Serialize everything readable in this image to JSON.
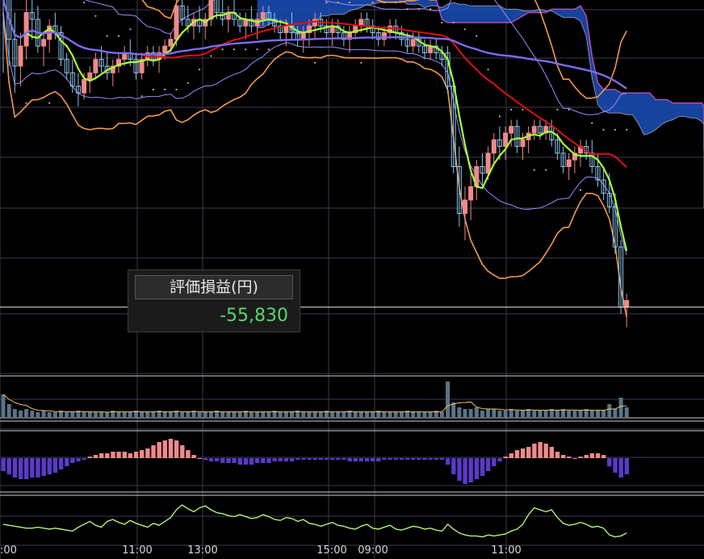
{
  "pl_panel": {
    "title": "評価損益(円)",
    "value": "-55,830"
  },
  "colors": {
    "background": "#000000",
    "grid": "#3b3b52",
    "up_candle": "#f08a8a",
    "down_candle": "#8cc8f0",
    "ma_short": "#a8ff3c",
    "ma_mid": "#e01010",
    "ma_long": "#7b6cf0",
    "bollinger_outer": "#f39a4a",
    "bollinger_inner": "#9a8cff",
    "cloud_upper": "#1a4fb8",
    "cloud_lower": "#b04cb8",
    "sar": "#f0a0a0",
    "macd_positive": "#f08a8a",
    "macd_negative": "#5a3ac8",
    "rsi": "#b6f07a"
  },
  "chart_data": {
    "type": "candlestick",
    "x_tick_labels": [
      ":00",
      "11:00",
      "13:00",
      "15:00",
      "09:00",
      "11:00"
    ],
    "gridlines": true,
    "legend": "none",
    "current_price_line": true,
    "panels": [
      "price",
      "volume",
      "macd_histogram",
      "rsi"
    ],
    "price": {
      "session1": [
        [
          29,
          30,
          9,
          20
        ],
        [
          20,
          24,
          10,
          14
        ],
        [
          14,
          18,
          6,
          10
        ],
        [
          10,
          15,
          7,
          13
        ],
        [
          13,
          21,
          11,
          18
        ],
        [
          18,
          22,
          14,
          17
        ],
        [
          17,
          19,
          12,
          13
        ],
        [
          13,
          15,
          10,
          14
        ],
        [
          14,
          17,
          12,
          16
        ],
        [
          16,
          18,
          14,
          15
        ],
        [
          15,
          16,
          10,
          11
        ],
        [
          11,
          12,
          8,
          9
        ],
        [
          9,
          11,
          6,
          7
        ],
        [
          7,
          9,
          4,
          6
        ],
        [
          6,
          9,
          5,
          8
        ],
        [
          8,
          10,
          6,
          9
        ],
        [
          9,
          12,
          8,
          11
        ],
        [
          11,
          13,
          9,
          10
        ],
        [
          10,
          12,
          8,
          9
        ],
        [
          9,
          11,
          7,
          10
        ],
        [
          10,
          12,
          9,
          11
        ],
        [
          11,
          13,
          10,
          12
        ],
        [
          12,
          14,
          10,
          11
        ],
        [
          11,
          12,
          8,
          9
        ],
        [
          9,
          12,
          8,
          11
        ],
        [
          11,
          13,
          10,
          12
        ],
        [
          12,
          13,
          10,
          11
        ],
        [
          11,
          13,
          9,
          12
        ],
        [
          12,
          14,
          11,
          13
        ],
        [
          13,
          15,
          12,
          14
        ],
        [
          14,
          20,
          13,
          19
        ],
        [
          19,
          23,
          16,
          17
        ],
        [
          17,
          19,
          15,
          16
        ],
        [
          16,
          18,
          14,
          17
        ],
        [
          17,
          19,
          15,
          16
        ],
        [
          16,
          18,
          14,
          17
        ],
        [
          17,
          21,
          16,
          20
        ],
        [
          20,
          22,
          17,
          18
        ],
        [
          18,
          20,
          16,
          17
        ],
        [
          17,
          19,
          15,
          18
        ],
        [
          18,
          20,
          16,
          17
        ],
        [
          17,
          18,
          15,
          16
        ],
        [
          16,
          18,
          14,
          17
        ],
        [
          17,
          19,
          15,
          16
        ],
        [
          16,
          18,
          14,
          17
        ],
        [
          17,
          19,
          16,
          18
        ],
        [
          18,
          19,
          16,
          17
        ],
        [
          17,
          18,
          15,
          16
        ],
        [
          16,
          17,
          14,
          15
        ],
        [
          15,
          17,
          13,
          16
        ],
        [
          16,
          18,
          14,
          15
        ],
        [
          15,
          16,
          13,
          14
        ],
        [
          14,
          16,
          12,
          15
        ],
        [
          15,
          17,
          13,
          16
        ],
        [
          16,
          18,
          14,
          17
        ],
        [
          17,
          18,
          15,
          16
        ],
        [
          16,
          17,
          14,
          15
        ],
        [
          15,
          17,
          13,
          16
        ],
        [
          16,
          17,
          14,
          15
        ],
        [
          15,
          16,
          13,
          14
        ],
        [
          14,
          16,
          12,
          15
        ],
        [
          15,
          17,
          14,
          16
        ],
        [
          16,
          18,
          15,
          17
        ],
        [
          17,
          18,
          15,
          16
        ],
        [
          16,
          17,
          14,
          15
        ],
        [
          15,
          16,
          13,
          14
        ],
        [
          14,
          16,
          13,
          15
        ],
        [
          15,
          17,
          14,
          16
        ],
        [
          16,
          17,
          14,
          15
        ],
        [
          15,
          16,
          13,
          14
        ],
        [
          14,
          15,
          12,
          13
        ],
        [
          13,
          15,
          12,
          14
        ],
        [
          14,
          15,
          12,
          13
        ],
        [
          13,
          14,
          11,
          12
        ],
        [
          12,
          14,
          11,
          13
        ],
        [
          13,
          14,
          11,
          12
        ],
        [
          12,
          13,
          10,
          11
        ]
      ],
      "session2": [
        [
          12,
          13,
          6,
          7
        ],
        [
          7,
          8,
          -6,
          -5
        ],
        [
          -5,
          -2,
          -14,
          -12
        ],
        [
          -12,
          -8,
          -16,
          -10
        ],
        [
          -10,
          -6,
          -13,
          -8
        ],
        [
          -8,
          -4,
          -10,
          -5
        ],
        [
          -5,
          -3,
          -8,
          -6
        ],
        [
          -6,
          -2,
          -7,
          -3
        ],
        [
          -3,
          0,
          -5,
          -1
        ],
        [
          -1,
          1,
          -4,
          -2
        ],
        [
          -2,
          1,
          -4,
          0
        ],
        [
          0,
          2,
          -2,
          1
        ],
        [
          1,
          2,
          -3,
          -2
        ],
        [
          -2,
          0,
          -4,
          -1
        ],
        [
          -1,
          1,
          -3,
          0
        ],
        [
          0,
          2,
          -1,
          1
        ],
        [
          1,
          2,
          -1,
          0
        ],
        [
          0,
          2,
          -1,
          1
        ],
        [
          1,
          2,
          -2,
          -1
        ],
        [
          -1,
          0,
          -4,
          -3
        ],
        [
          -3,
          -2,
          -6,
          -5
        ],
        [
          -5,
          -3,
          -7,
          -4
        ],
        [
          -4,
          -2,
          -6,
          -3
        ],
        [
          -3,
          -1,
          -5,
          -2
        ],
        [
          -2,
          -1,
          -4,
          -3
        ],
        [
          -3,
          -1,
          -6,
          -5
        ],
        [
          -5,
          -3,
          -8,
          -7
        ],
        [
          -7,
          -5,
          -10,
          -9
        ],
        [
          -9,
          -6,
          -12,
          -11
        ],
        [
          -11,
          -9,
          -18,
          -17
        ],
        [
          -17,
          -16,
          -27,
          -26
        ],
        [
          -26,
          -24,
          -29,
          -25
        ]
      ],
      "current_price": -26
    },
    "volume": {
      "session1": [
        14,
        8,
        5,
        4,
        5,
        4,
        3,
        4,
        3,
        3,
        4,
        3,
        3,
        4,
        3,
        3,
        3,
        3,
        3,
        4,
        3,
        3,
        3,
        4,
        3,
        3,
        3,
        4,
        3,
        3,
        4,
        3,
        3,
        4,
        3,
        3,
        3,
        4,
        3,
        3,
        3,
        3,
        4,
        3,
        3,
        3,
        3,
        4,
        3,
        3,
        3,
        4,
        3,
        3,
        3,
        3,
        4,
        3,
        3,
        3,
        4,
        3,
        3,
        3,
        3,
        4,
        3,
        3,
        3,
        3,
        4,
        3,
        3,
        3,
        3,
        4,
        3
      ],
      "session2": [
        22,
        9,
        6,
        5,
        5,
        6,
        4,
        5,
        5,
        4,
        4,
        5,
        4,
        4,
        5,
        4,
        4,
        4,
        5,
        4,
        5,
        4,
        4,
        4,
        5,
        4,
        4,
        4,
        8,
        5,
        12,
        6
      ]
    },
    "macd_histogram": {
      "session1": [
        -8,
        -10,
        -12,
        -13,
        -13,
        -12,
        -12,
        -11,
        -10,
        -9,
        -7,
        -5,
        -3,
        -2,
        -1,
        1,
        2,
        3,
        3,
        4,
        4,
        4,
        3,
        4,
        5,
        6,
        8,
        10,
        11,
        12,
        11,
        8,
        5,
        2,
        0,
        -1,
        -2,
        -2,
        -3,
        -3,
        -3,
        -4,
        -4,
        -4,
        -3,
        -3,
        -3,
        -2,
        -2,
        -2,
        -2,
        -1,
        -1,
        -1,
        -1,
        -1,
        -1,
        -1,
        -1,
        -1,
        -2,
        -2,
        -2,
        -2,
        -2,
        -2,
        -1,
        -1,
        -1,
        -1,
        -1,
        -1,
        -1,
        -1,
        -1,
        -1,
        -1
      ],
      "session2": [
        -4,
        -10,
        -14,
        -16,
        -15,
        -13,
        -11,
        -8,
        -5,
        -2,
        1,
        3,
        5,
        6,
        7,
        9,
        10,
        9,
        7,
        4,
        2,
        1,
        0,
        1,
        2,
        3,
        3,
        2,
        -5,
        -9,
        -12,
        -10
      ]
    },
    "rsi": {
      "session1": [
        45,
        44,
        43,
        42,
        41,
        41,
        42,
        41,
        40,
        41,
        40,
        39,
        38,
        42,
        45,
        48,
        44,
        42,
        48,
        50,
        47,
        45,
        49,
        46,
        44,
        42,
        46,
        44,
        48,
        52,
        60,
        65,
        61,
        58,
        62,
        64,
        60,
        57,
        56,
        54,
        53,
        55,
        53,
        51,
        52,
        55,
        53,
        50,
        49,
        52,
        51,
        48,
        50,
        46,
        45,
        43,
        45,
        47,
        44,
        43,
        41,
        40,
        43,
        45,
        41,
        40,
        42,
        44,
        40,
        39,
        41,
        43,
        42,
        40,
        41,
        39,
        38
      ],
      "session2": [
        45,
        40,
        36,
        34,
        33,
        33,
        32,
        34,
        33,
        34,
        35,
        38,
        40,
        45,
        55,
        62,
        60,
        58,
        60,
        52,
        46,
        44,
        45,
        47,
        45,
        42,
        43,
        41,
        34,
        32,
        33,
        36
      ]
    }
  }
}
